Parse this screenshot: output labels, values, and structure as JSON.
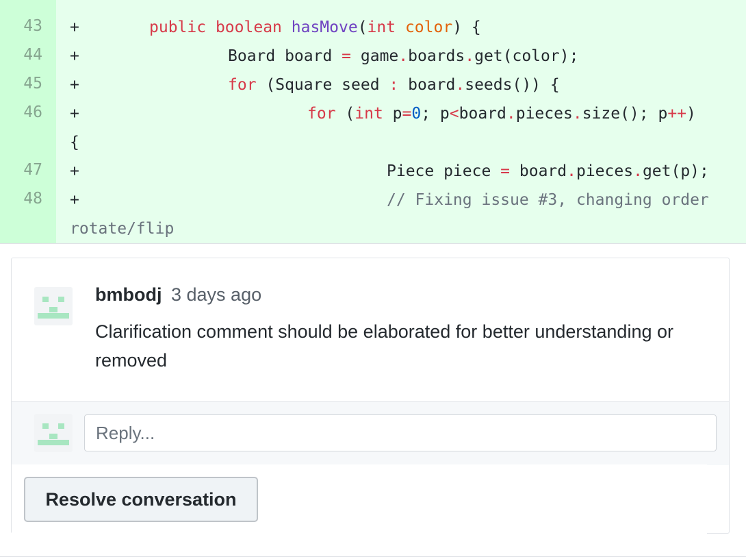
{
  "diff": {
    "lines": [
      {
        "num": "43",
        "sign": "+"
      },
      {
        "num": "44",
        "sign": "+"
      },
      {
        "num": "45",
        "sign": "+"
      },
      {
        "num": "46",
        "sign": "+"
      },
      {
        "num": "47",
        "sign": "+"
      },
      {
        "num": "48",
        "sign": "+"
      }
    ],
    "code": {
      "l43": {
        "kw1": "public",
        "kw2": "boolean",
        "fn": "hasMove",
        "p1": "(",
        "type": "int",
        "param": "color",
        "p2": ") {"
      },
      "l44": {
        "t1": "Board board ",
        "op1": "=",
        "t2": " game",
        "op2": ".",
        "t3": "boards",
        "op3": ".",
        "t4": "get(color);"
      },
      "l45": {
        "kw": "for",
        "t1": " (Square seed ",
        "op1": ":",
        "t2": " board",
        "op2": ".",
        "t3": "seeds()) {"
      },
      "l46": {
        "kw": "for",
        "t1": " (",
        "type": "int",
        "t2": " p",
        "op1": "=",
        "num": "0",
        "t3": "; p",
        "op2": "<",
        "t4": "board",
        "op3": ".",
        "t5": "pieces",
        "op4": ".",
        "t6": "size(); p",
        "op5": "++",
        "t7": ")"
      },
      "l46b": "{",
      "l47": {
        "t1": "Piece piece ",
        "op1": "=",
        "t2": " board",
        "op2": ".",
        "t3": "pieces",
        "op3": ".",
        "t4": "get(p);"
      },
      "l48": "// Fixing issue #3, changing order",
      "l48b": "rotate/flip"
    }
  },
  "comment": {
    "author": "bmbodj",
    "time": "3 days ago",
    "body": "Clarification comment should be elaborated for better understanding or removed"
  },
  "reply": {
    "placeholder": "Reply..."
  },
  "actions": {
    "resolve_label": "Resolve conversation"
  }
}
